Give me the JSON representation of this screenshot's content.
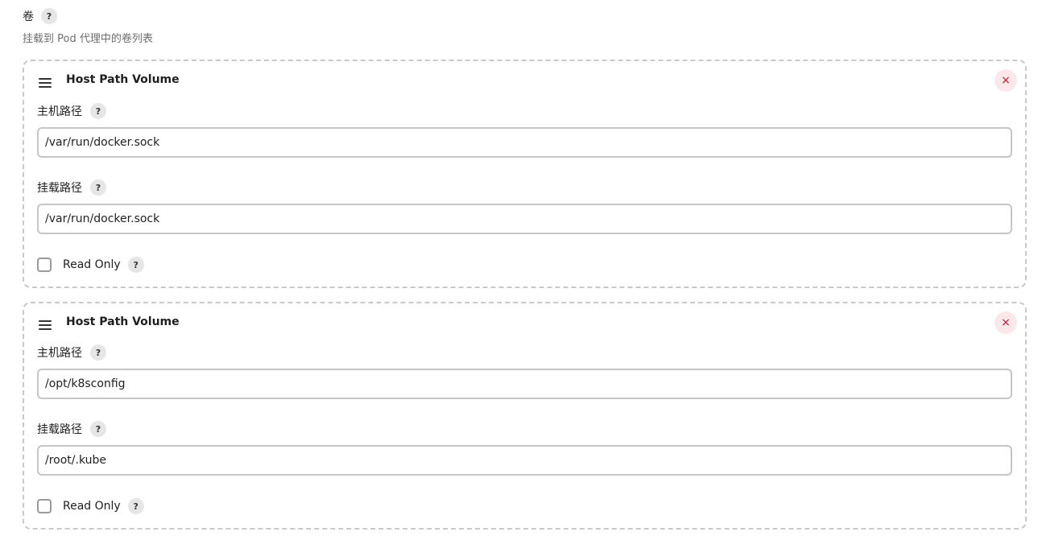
{
  "section": {
    "title": "卷",
    "description": "挂载到 Pod 代理中的卷列表",
    "help": "?"
  },
  "volumes": [
    {
      "title": "Host Path Volume",
      "remove": "×",
      "host_path_label": "主机路径",
      "host_path_value": "/var/run/docker.sock",
      "mount_path_label": "挂载路径",
      "mount_path_value": "/var/run/docker.sock",
      "read_only_label": "Read Only",
      "read_only_checked": false,
      "help": "?"
    },
    {
      "title": "Host Path Volume",
      "remove": "×",
      "host_path_label": "主机路径",
      "host_path_value": "/opt/k8sconfig",
      "mount_path_label": "挂载路径",
      "mount_path_value": "/root/.kube",
      "read_only_label": "Read Only",
      "read_only_checked": false,
      "help": "?"
    }
  ],
  "colors": {
    "remove_icon": "#c8102e",
    "remove_bg": "#fbe8ea",
    "card_border": "#c9c9c9",
    "description_text": "#6e6e6e"
  },
  "icons": {
    "drag": "drag-handle-icon",
    "remove": "close-icon",
    "help": "help-icon"
  }
}
